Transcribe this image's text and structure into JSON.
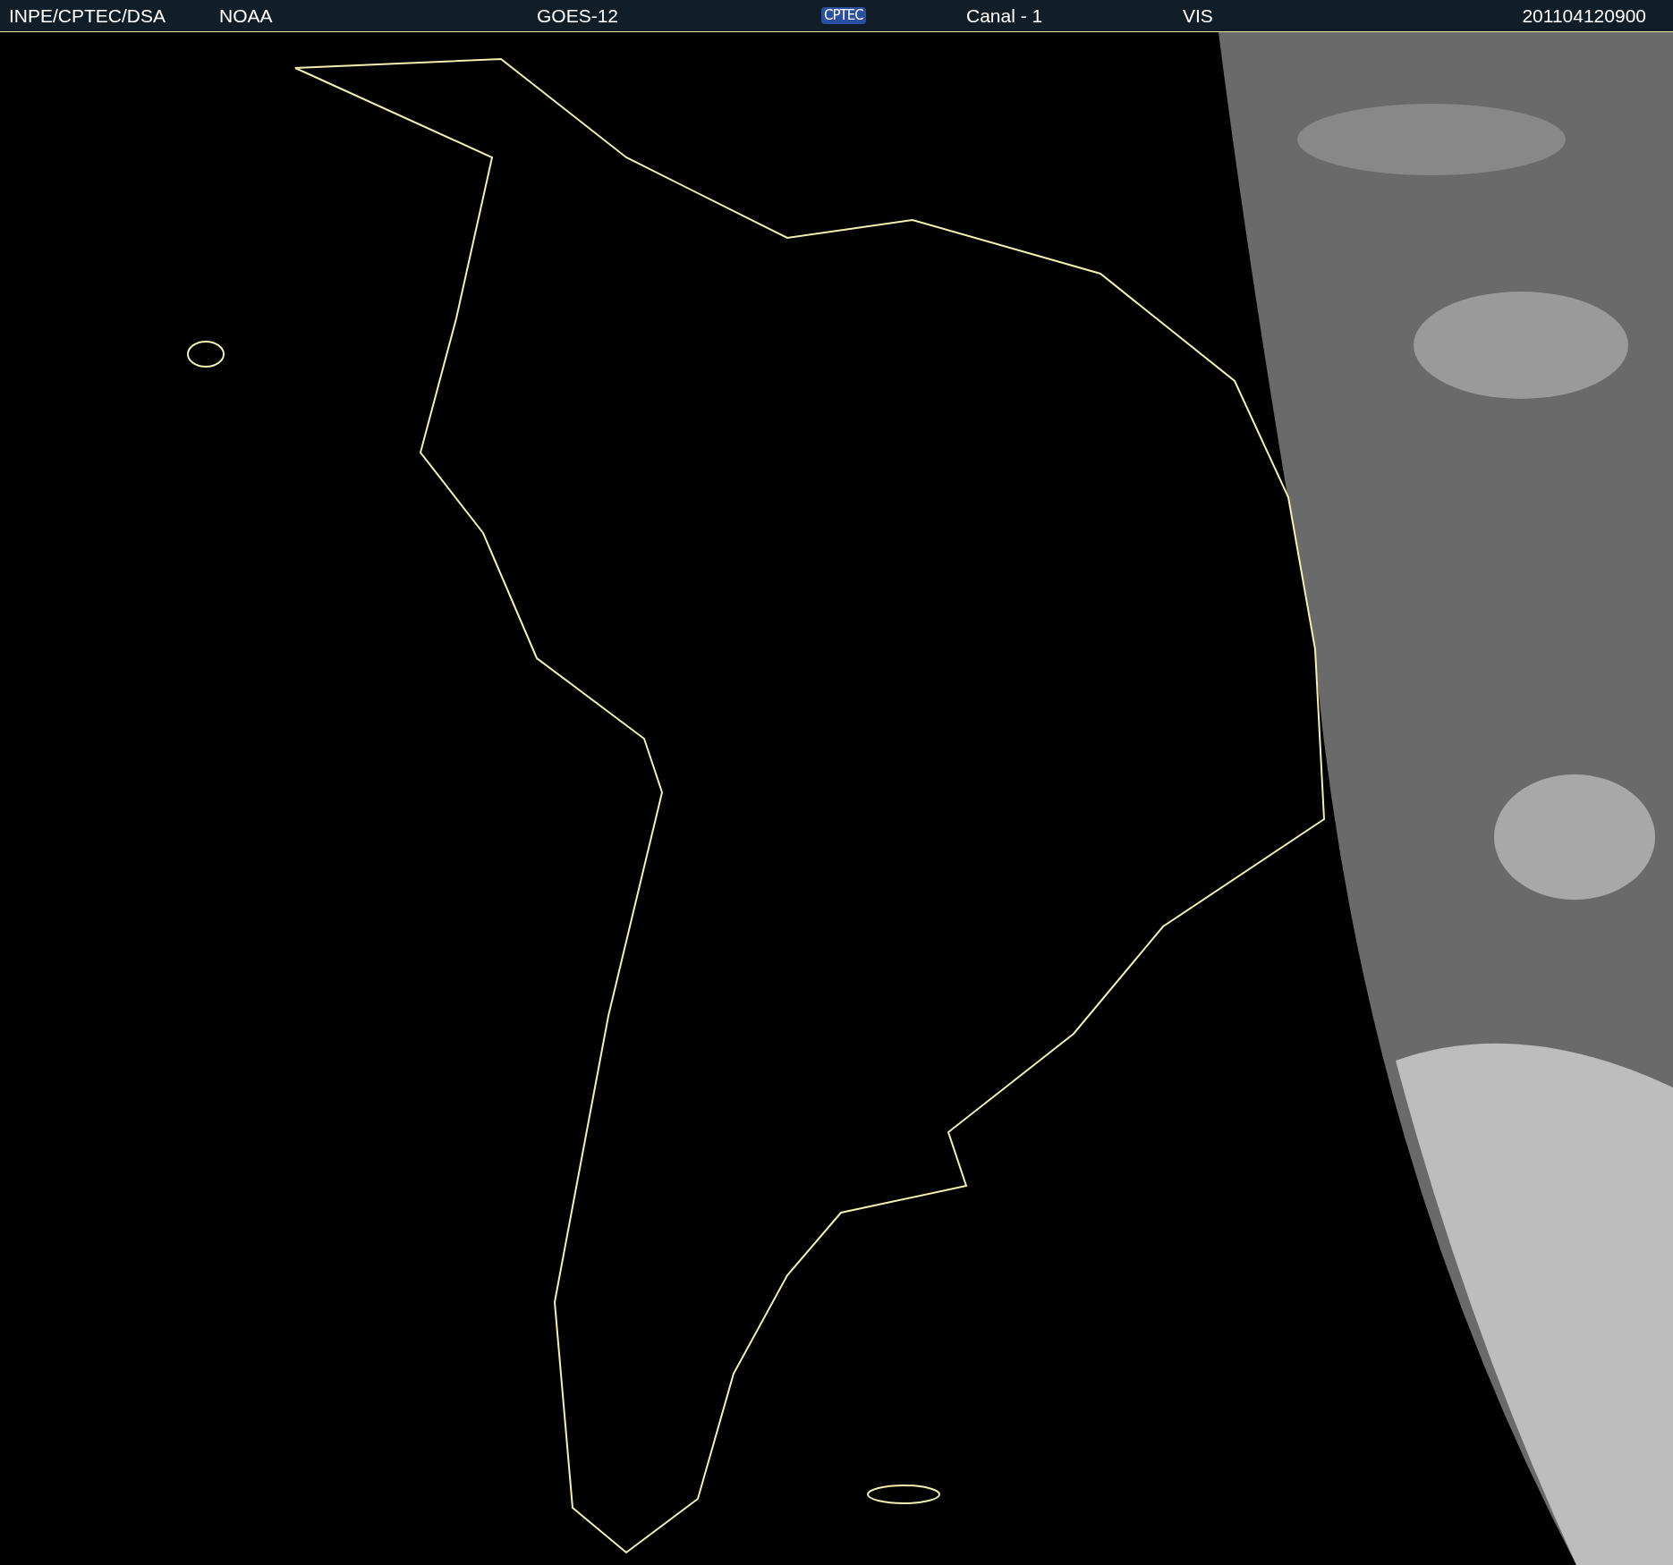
{
  "header": {
    "items": [
      {
        "kind": "text",
        "label": "INPE/CPTEC/DSA"
      },
      {
        "kind": "text",
        "label": "NOAA"
      },
      {
        "kind": "text",
        "label": "GOES-12"
      },
      {
        "kind": "logo",
        "label": "CPTEC"
      },
      {
        "kind": "text",
        "label": "Canal - 1"
      },
      {
        "kind": "text",
        "label": "VIS"
      },
      {
        "kind": "text",
        "label": "201104120900"
      }
    ]
  }
}
